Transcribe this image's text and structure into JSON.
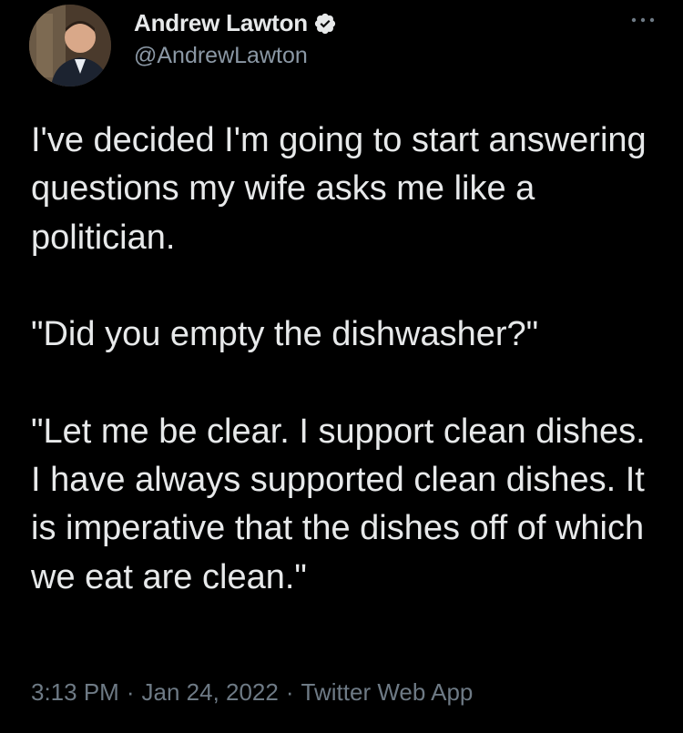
{
  "author": {
    "display_name": "Andrew Lawton",
    "handle": "@AndrewLawton",
    "verified_icon": "verified-badge-icon",
    "avatar_icon": "profile-avatar"
  },
  "menu": {
    "icon": "more-options-icon"
  },
  "tweet": {
    "text": "I've decided I'm going to start answering questions my wife asks me like a politician.\n\n\"Did you empty the dishwasher?\"\n\n\"Let me be clear. I support clean dishes. I have always supported clean dishes. It is imperative that the dishes off of which we eat are clean.\""
  },
  "meta": {
    "time": "3:13 PM",
    "date": "Jan 24, 2022",
    "source": "Twitter Web App",
    "separator": "·"
  },
  "colors": {
    "background": "#000000",
    "primary_text": "#e7e9ea",
    "secondary_text": "#8b98a5"
  }
}
